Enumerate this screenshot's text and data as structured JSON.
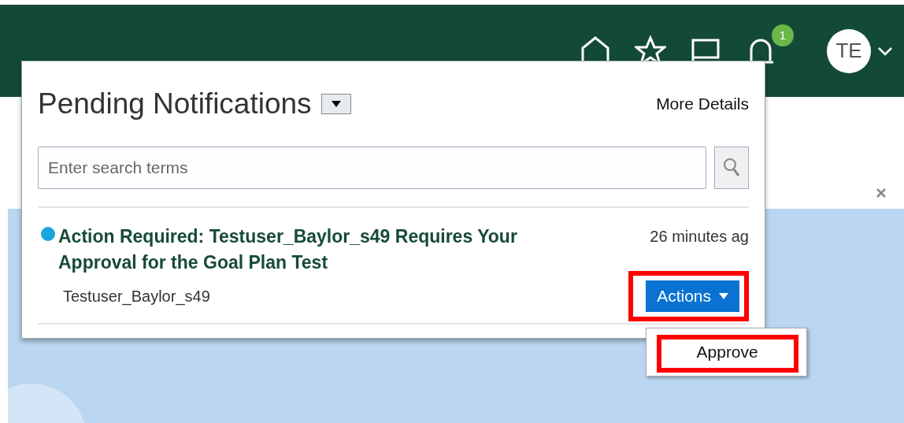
{
  "header": {
    "badge": "1",
    "avatar": "TE"
  },
  "panel": {
    "title": "Pending Notifications",
    "more_link": "More Details",
    "search": {
      "placeholder": "Enter search terms"
    },
    "notifications": [
      {
        "unread": true,
        "title": "Action Required: Testuser_Baylor_s49 Requires Your Approval for the Goal Plan Test",
        "time": "26 minutes ag",
        "sender": "Testuser_Baylor_s49",
        "actions_label": "Actions",
        "actions_highlighted": true,
        "menu": [
          {
            "label": "Approve",
            "highlighted": true
          }
        ]
      }
    ]
  }
}
